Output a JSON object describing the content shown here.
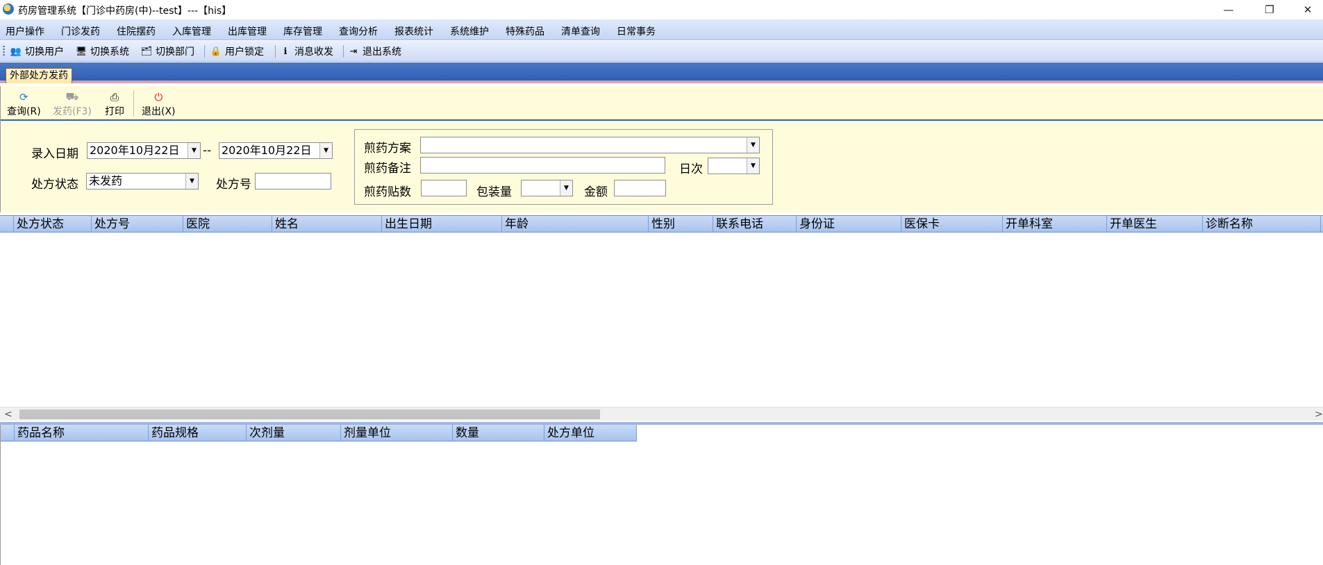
{
  "window": {
    "title": "药房管理系统【门诊中药房(中)--test】---【his】",
    "min_glyph": "—",
    "max_glyph": "❐",
    "close_glyph": "✕"
  },
  "menu": [
    "用户操作",
    "门诊发药",
    "住院摆药",
    "入库管理",
    "出库管理",
    "库存管理",
    "查询分析",
    "报表统计",
    "系统维护",
    "特殊药品",
    "清单查询",
    "日常事务"
  ],
  "toolbar": [
    {
      "label": "切换用户",
      "icon": "switch-user-icon",
      "glyph": "👥"
    },
    {
      "label": "切换系统",
      "icon": "switch-system-icon",
      "glyph": "🖥"
    },
    {
      "label": "切换部门",
      "icon": "switch-department-icon",
      "glyph": "🗂"
    },
    {
      "label": "用户锁定",
      "icon": "user-lock-icon",
      "glyph": "🔒"
    },
    {
      "label": "消息收发",
      "icon": "message-icon",
      "glyph": "ℹ"
    },
    {
      "label": "退出系统",
      "icon": "exit-system-icon",
      "glyph": "⇥"
    }
  ],
  "tab": {
    "label": "外部处方发药"
  },
  "actions": [
    {
      "label": "查询(R)",
      "icon": "refresh-icon",
      "glyph": "⟳",
      "enabled": true
    },
    {
      "label": "发药(F3)",
      "icon": "dispense-icon",
      "glyph": "⛟",
      "enabled": false
    },
    {
      "label": "打印",
      "icon": "print-icon",
      "glyph": "⎙",
      "enabled": true
    },
    {
      "label": "退出(X)",
      "icon": "power-icon",
      "glyph": "⏻",
      "enabled": true
    }
  ],
  "filters": {
    "entry_date_label": "录入日期",
    "date_from": "2020年10月22日",
    "date_separator": "--",
    "date_to": "2020年10月22日",
    "status_label": "处方状态",
    "status_value": "未发药",
    "rx_no_label": "处方号",
    "rx_no_value": ""
  },
  "decoction": {
    "scheme_label": "煎药方案",
    "scheme_value": "",
    "note_label": "煎药备注",
    "note_value": "",
    "daily_label": "日次",
    "daily_value": "",
    "doses_label": "煎药贴数",
    "doses_value": "",
    "package_label": "包装量",
    "package_value": "",
    "amount_label": "金额",
    "amount_value": ""
  },
  "prescription_grid": {
    "columns": [
      "处方状态",
      "处方号",
      "医院",
      "姓名",
      "出生日期",
      "年龄",
      "性别",
      "联系电话",
      "身份证",
      "医保卡",
      "开单科室",
      "开单医生",
      "诊断名称"
    ],
    "rows": []
  },
  "scrollbar": {
    "left_arrow": "<",
    "right_arrow": ">"
  },
  "detail_grid": {
    "columns": [
      "药品名称",
      "药品规格",
      "次剂量",
      "剂量单位",
      "数量",
      "处方单位"
    ],
    "rows": []
  },
  "colors": {
    "menu_bg": "#c3d6f4",
    "tab_strip": "#2f5fb5",
    "work_area": "#fffcdc",
    "grid_header": "#a9c3ee",
    "power_red": "#e0241a"
  }
}
